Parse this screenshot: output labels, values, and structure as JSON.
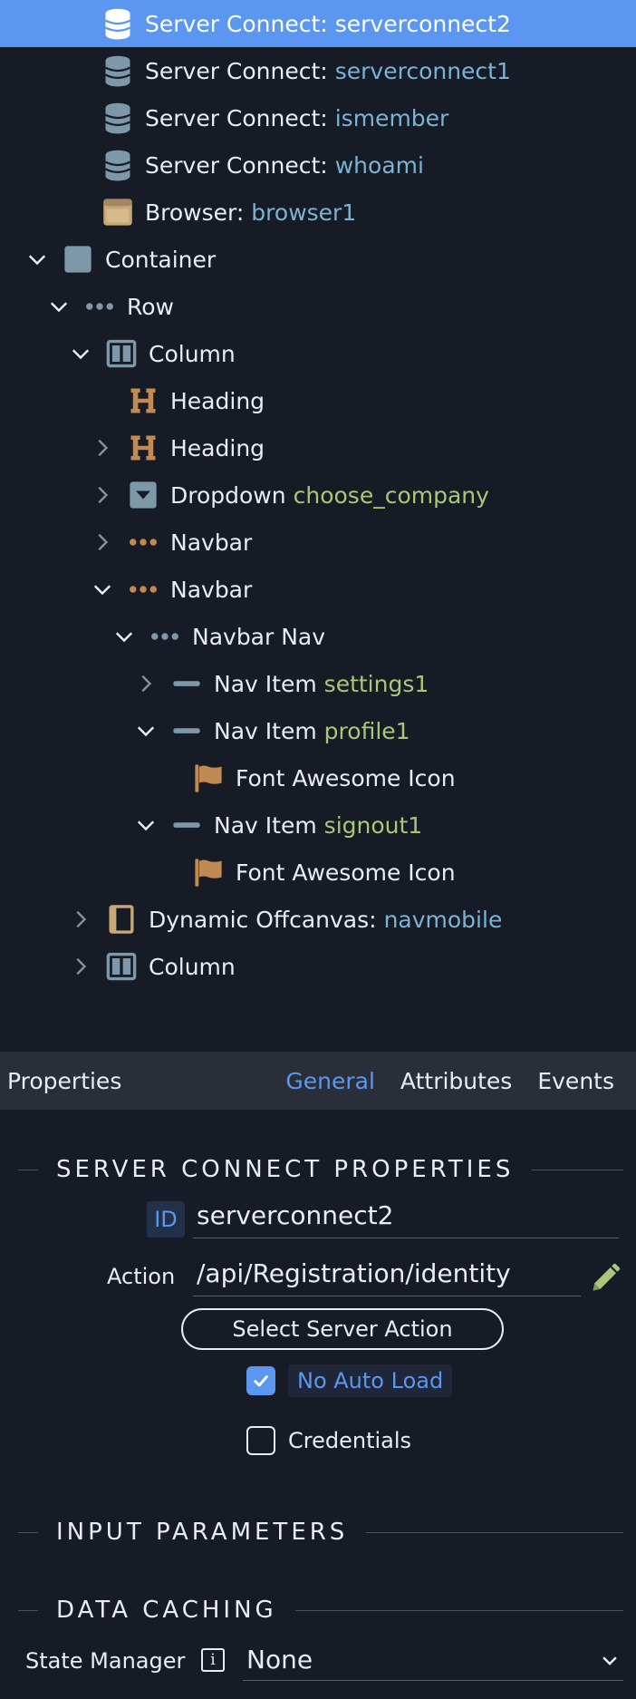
{
  "tree": [
    {
      "indent": 70,
      "chevron": "none",
      "icon": "database-icon",
      "label": "Server Connect:",
      "ref": "serverconnect2",
      "ref_color": "blue",
      "selected": true
    },
    {
      "indent": 70,
      "chevron": "none",
      "icon": "database-icon",
      "label": "Server Connect:",
      "ref": "serverconnect1",
      "ref_color": "blue",
      "selected": false
    },
    {
      "indent": 70,
      "chevron": "none",
      "icon": "database-icon",
      "label": "Server Connect:",
      "ref": "ismember",
      "ref_color": "blue",
      "selected": false
    },
    {
      "indent": 70,
      "chevron": "none",
      "icon": "database-icon",
      "label": "Server Connect:",
      "ref": "whoami",
      "ref_color": "blue",
      "selected": false
    },
    {
      "indent": 70,
      "chevron": "none",
      "icon": "browser-icon",
      "label": "Browser:",
      "ref": "browser1",
      "ref_color": "blue",
      "selected": false
    },
    {
      "indent": 26,
      "chevron": "down",
      "icon": "container-icon",
      "label": "Container",
      "ref": "",
      "ref_color": "",
      "selected": false
    },
    {
      "indent": 50,
      "chevron": "down",
      "icon": "row-dots-icon",
      "label": "Row",
      "ref": "",
      "ref_color": "",
      "selected": false
    },
    {
      "indent": 74,
      "chevron": "down",
      "icon": "column-icon",
      "label": "Column",
      "ref": "",
      "ref_color": "",
      "selected": false
    },
    {
      "indent": 98,
      "chevron": "none",
      "icon": "heading-icon",
      "label": "Heading",
      "ref": "",
      "ref_color": "",
      "selected": false
    },
    {
      "indent": 98,
      "chevron": "right",
      "icon": "heading-icon",
      "label": "Heading",
      "ref": "",
      "ref_color": "",
      "selected": false
    },
    {
      "indent": 98,
      "chevron": "right",
      "icon": "dropdown-icon",
      "label": "Dropdown",
      "ref": "choose_company",
      "ref_color": "green",
      "selected": false
    },
    {
      "indent": 98,
      "chevron": "right",
      "icon": "navbar-dots-icon",
      "label": "Navbar",
      "ref": "",
      "ref_color": "",
      "selected": false
    },
    {
      "indent": 98,
      "chevron": "down",
      "icon": "navbar-dots-icon",
      "label": "Navbar",
      "ref": "",
      "ref_color": "",
      "selected": false
    },
    {
      "indent": 122,
      "chevron": "down",
      "icon": "nav-dots-icon",
      "label": "Navbar Nav",
      "ref": "",
      "ref_color": "",
      "selected": false
    },
    {
      "indent": 146,
      "chevron": "right",
      "icon": "nav-item-icon",
      "label": "Nav Item",
      "ref": "settings1",
      "ref_color": "green",
      "selected": false
    },
    {
      "indent": 146,
      "chevron": "down",
      "icon": "nav-item-icon",
      "label": "Nav Item",
      "ref": "profile1",
      "ref_color": "green",
      "selected": false
    },
    {
      "indent": 170,
      "chevron": "none",
      "icon": "flag-icon",
      "label": "Font Awesome Icon",
      "ref": "",
      "ref_color": "",
      "selected": false
    },
    {
      "indent": 146,
      "chevron": "down",
      "icon": "nav-item-icon",
      "label": "Nav Item",
      "ref": "signout1",
      "ref_color": "green",
      "selected": false
    },
    {
      "indent": 170,
      "chevron": "none",
      "icon": "flag-icon",
      "label": "Font Awesome Icon",
      "ref": "",
      "ref_color": "",
      "selected": false
    },
    {
      "indent": 74,
      "chevron": "right",
      "icon": "offcanvas-icon",
      "label": "Dynamic Offcanvas:",
      "ref": "navmobile",
      "ref_color": "blue",
      "selected": false
    },
    {
      "indent": 74,
      "chevron": "right",
      "icon": "column-icon",
      "label": "Column",
      "ref": "",
      "ref_color": "",
      "selected": false
    }
  ],
  "properties": {
    "title": "Properties",
    "tabs": [
      "General",
      "Attributes",
      "Events"
    ],
    "active_tab": "General",
    "section_server": "SERVER CONNECT PROPERTIES",
    "id_label": "ID",
    "id_value": "serverconnect2",
    "action_label": "Action",
    "action_value": "/api/Registration/identity",
    "select_button": "Select Server Action",
    "no_auto_load": {
      "label": "No Auto Load",
      "checked": true
    },
    "credentials": {
      "label": "Credentials",
      "checked": false
    },
    "section_input": "INPUT PARAMETERS",
    "section_caching": "DATA CACHING",
    "state_manager_label": "State Manager",
    "state_manager_value": "None"
  },
  "colors": {
    "background": "#161b26",
    "selected": "#5b97f0",
    "ref_blue": "#7ab3d4",
    "ref_green": "#a9c877",
    "icon_steel": "#7d98a8",
    "icon_tan": "#c8a877",
    "icon_orange": "#c08a52"
  }
}
